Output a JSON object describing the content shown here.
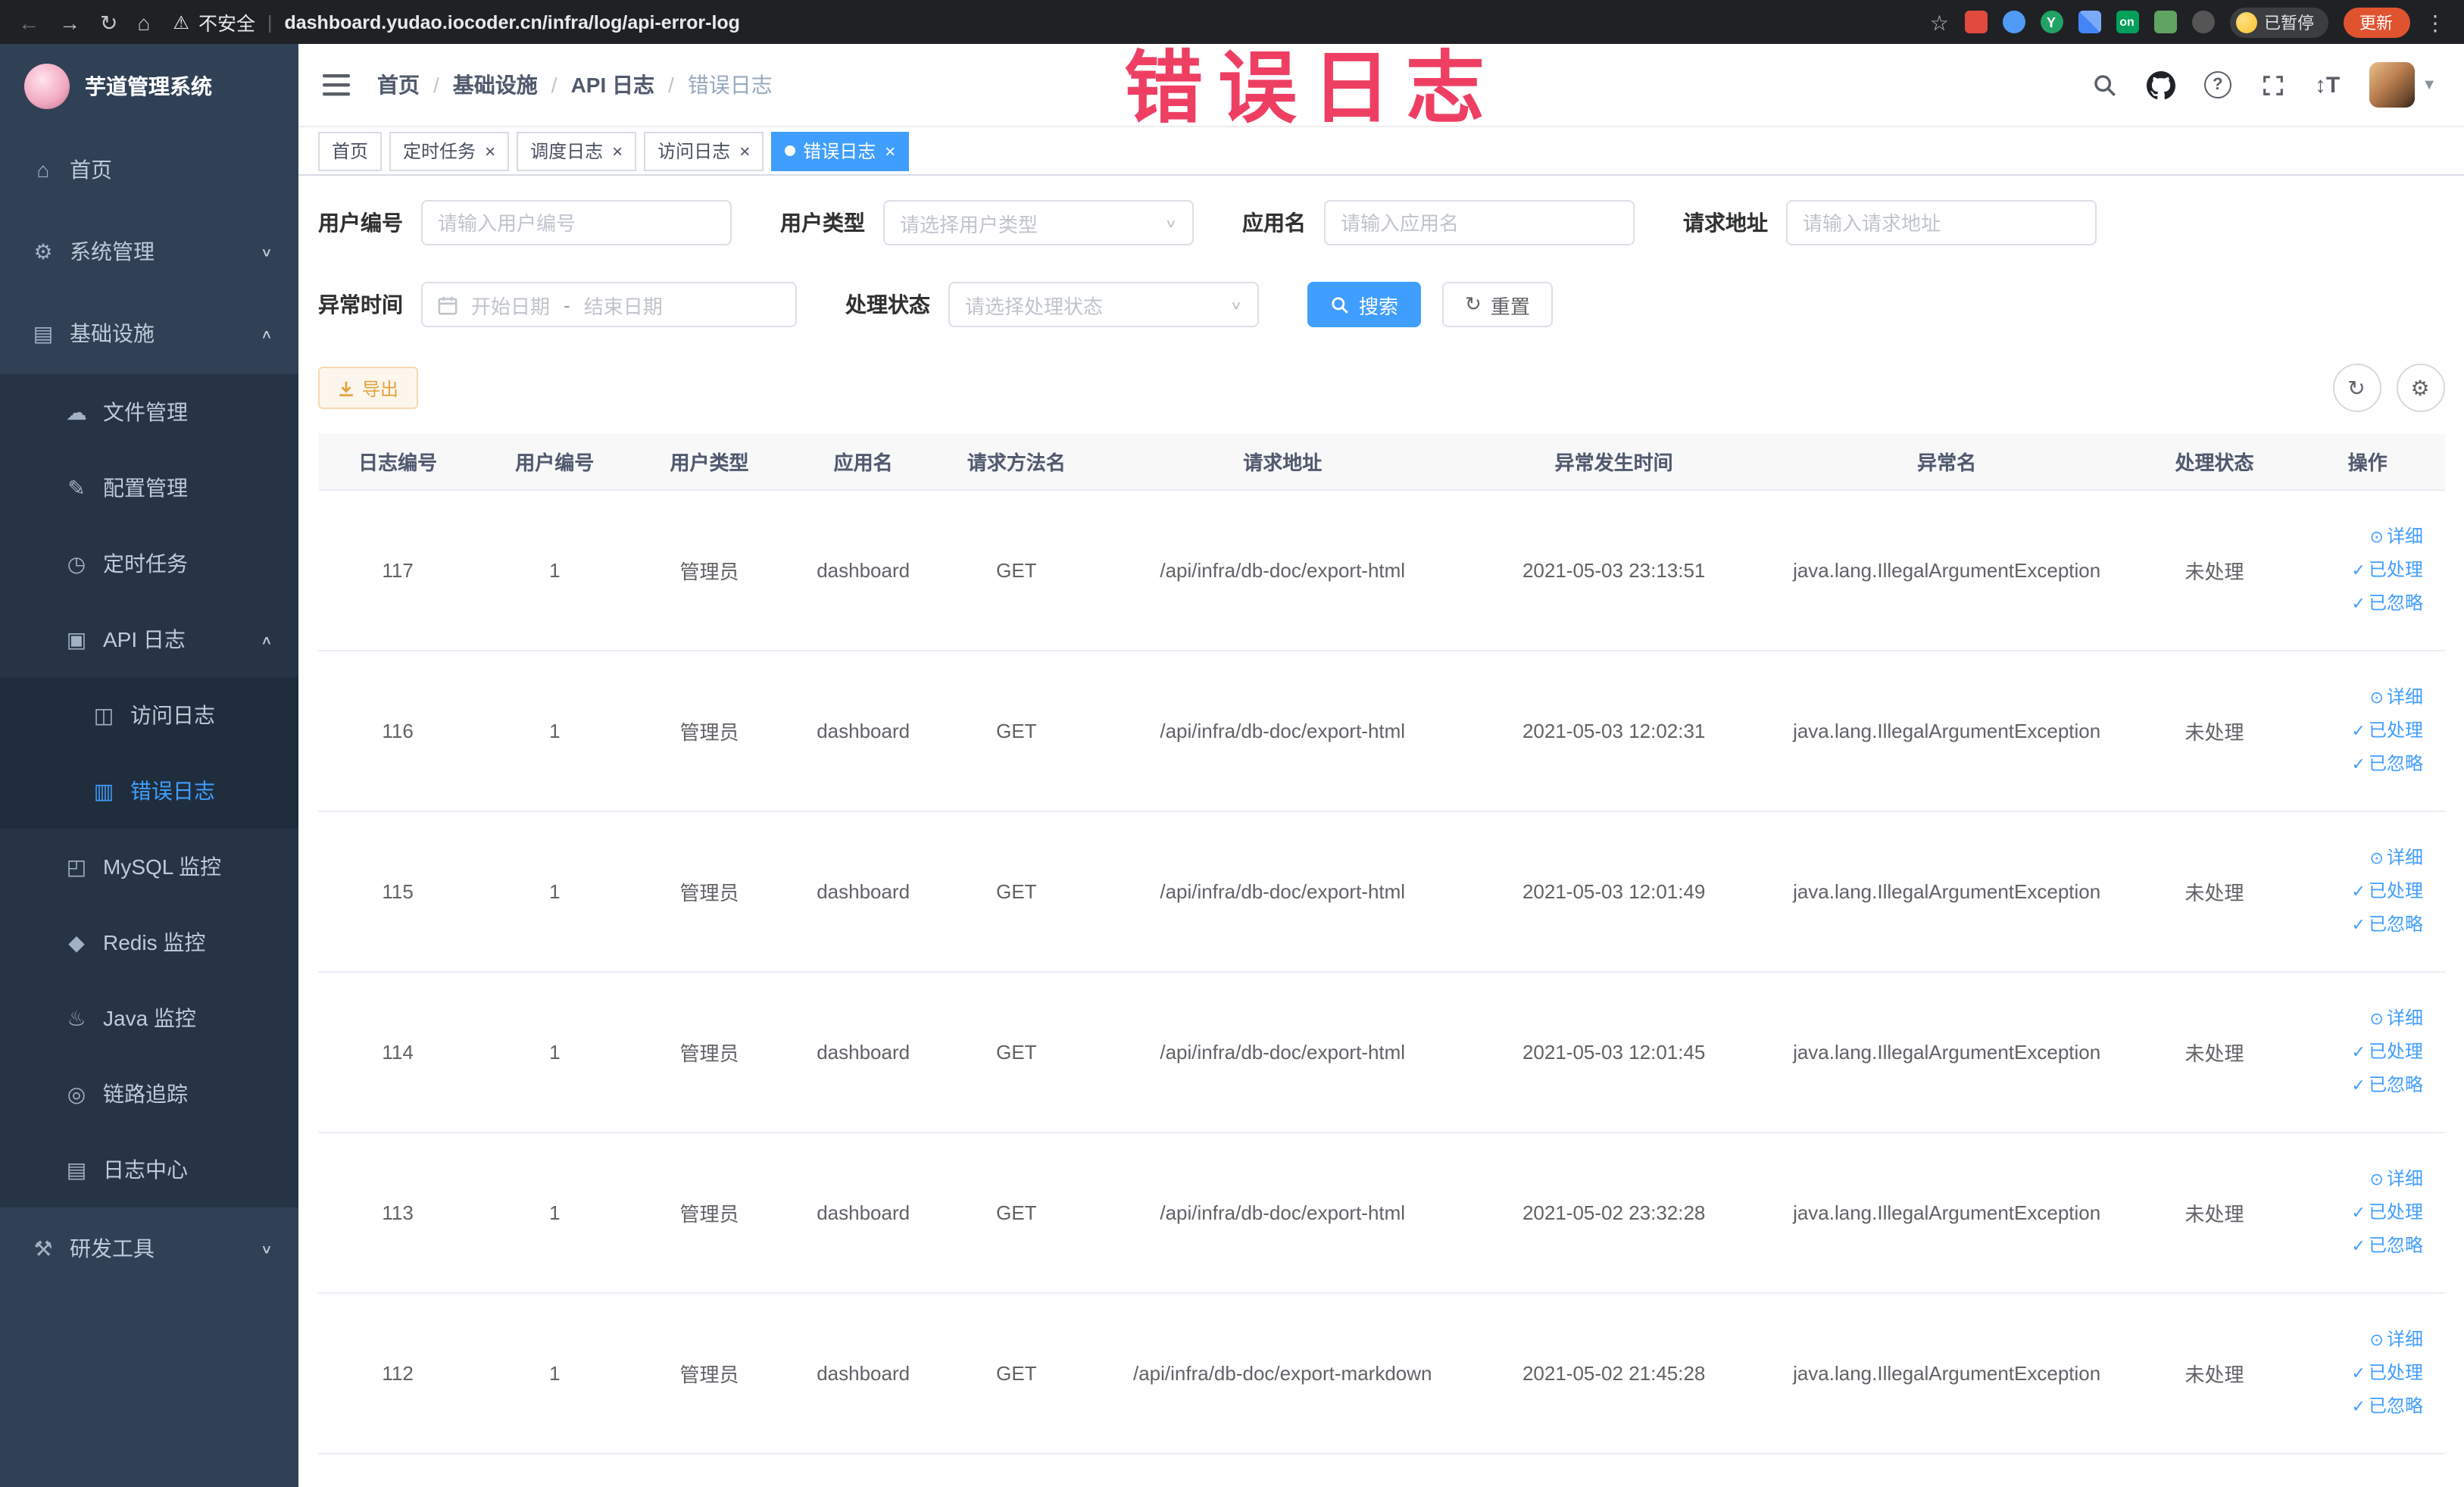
{
  "browser": {
    "security_text": "不安全",
    "url": "dashboard.yudao.iocoder.cn/infra/log/api-error-log",
    "paused_badge": "已暂停",
    "update_button": "更新"
  },
  "annotation": {
    "text": "错误日志",
    "color": "#ee3f63"
  },
  "sidebar": {
    "logo_title": "芋道管理系统",
    "items": [
      {
        "key": "home",
        "label": "首页",
        "icon": "home-icon",
        "glyph": "⌂",
        "level": 1
      },
      {
        "key": "system-mgmt",
        "label": "系统管理",
        "icon": "gear-icon",
        "glyph": "⚙",
        "level": 1,
        "chevron": "down"
      },
      {
        "key": "infrastructure",
        "label": "基础设施",
        "icon": "infra-icon",
        "glyph": "▤",
        "level": 1,
        "chevron": "up"
      },
      {
        "key": "file-mgmt",
        "label": "文件管理",
        "icon": "file-icon",
        "glyph": "☁",
        "level": 2
      },
      {
        "key": "config-mgmt",
        "label": "配置管理",
        "icon": "edit-icon",
        "glyph": "✎",
        "level": 2
      },
      {
        "key": "job",
        "label": "定时任务",
        "icon": "clock-icon",
        "glyph": "◷",
        "level": 2
      },
      {
        "key": "api-log",
        "label": "API 日志",
        "icon": "api-log-icon",
        "glyph": "▣",
        "level": 2,
        "chevron": "up"
      },
      {
        "key": "access-log",
        "label": "访问日志",
        "icon": "access-log-icon",
        "glyph": "◫",
        "level": 3
      },
      {
        "key": "error-log",
        "label": "错误日志",
        "icon": "error-log-icon",
        "glyph": "▥",
        "level": 3,
        "active": true
      },
      {
        "key": "mysql-monitor",
        "label": "MySQL 监控",
        "icon": "database-icon",
        "glyph": "◰",
        "level": 2
      },
      {
        "key": "redis-monitor",
        "label": "Redis 监控",
        "icon": "redis-icon",
        "glyph": "◆",
        "level": 2
      },
      {
        "key": "java-monitor",
        "label": "Java 监控",
        "icon": "java-icon",
        "glyph": "♨",
        "level": 2
      },
      {
        "key": "trace",
        "label": "链路追踪",
        "icon": "trace-icon",
        "glyph": "◎",
        "level": 2
      },
      {
        "key": "log-center",
        "label": "日志中心",
        "icon": "log-center-icon",
        "glyph": "▤",
        "level": 2
      },
      {
        "key": "dev-tools",
        "label": "研发工具",
        "icon": "tools-icon",
        "glyph": "⚒",
        "level": 1,
        "chevron": "down"
      }
    ]
  },
  "header": {
    "breadcrumbs": [
      "首页",
      "基础设施",
      "API 日志",
      "错误日志"
    ]
  },
  "tabs": [
    {
      "key": "home",
      "label": "首页",
      "closable": false,
      "active": false
    },
    {
      "key": "job",
      "label": "定时任务",
      "closable": true,
      "active": false
    },
    {
      "key": "job-log",
      "label": "调度日志",
      "closable": true,
      "active": false
    },
    {
      "key": "access-log",
      "label": "访问日志",
      "closable": true,
      "active": false
    },
    {
      "key": "error-log",
      "label": "错误日志",
      "closable": true,
      "active": true
    }
  ],
  "filters": {
    "user_id": {
      "label": "用户编号",
      "placeholder": "请输入用户编号"
    },
    "user_type": {
      "label": "用户类型",
      "placeholder": "请选择用户类型"
    },
    "app_name": {
      "label": "应用名",
      "placeholder": "请输入应用名"
    },
    "request_url": {
      "label": "请求地址",
      "placeholder": "请输入请求地址"
    },
    "exception_time": {
      "label": "异常时间",
      "start_placeholder": "开始日期",
      "separator": "-",
      "end_placeholder": "结束日期"
    },
    "process_status": {
      "label": "处理状态",
      "placeholder": "请选择处理状态"
    },
    "search_button": "搜索",
    "reset_button": "重置"
  },
  "toolbar": {
    "export_button": "导出"
  },
  "table": {
    "columns": [
      "日志编号",
      "用户编号",
      "用户类型",
      "应用名",
      "请求方法名",
      "请求地址",
      "异常发生时间",
      "异常名",
      "处理状态",
      "操作"
    ],
    "actions": {
      "detail": "详细",
      "processed": "已处理",
      "ignored": "已忽略"
    },
    "rows": [
      {
        "id": "117",
        "user_id": "1",
        "user_type": "管理员",
        "app": "dashboard",
        "method": "GET",
        "url": "/api/infra/db-doc/export-html",
        "time": "2021-05-03 23:13:51",
        "exception": "java.lang.IllegalArgumentException",
        "status": "未处理"
      },
      {
        "id": "116",
        "user_id": "1",
        "user_type": "管理员",
        "app": "dashboard",
        "method": "GET",
        "url": "/api/infra/db-doc/export-html",
        "time": "2021-05-03 12:02:31",
        "exception": "java.lang.IllegalArgumentException",
        "status": "未处理"
      },
      {
        "id": "115",
        "user_id": "1",
        "user_type": "管理员",
        "app": "dashboard",
        "method": "GET",
        "url": "/api/infra/db-doc/export-html",
        "time": "2021-05-03 12:01:49",
        "exception": "java.lang.IllegalArgumentException",
        "status": "未处理"
      },
      {
        "id": "114",
        "user_id": "1",
        "user_type": "管理员",
        "app": "dashboard",
        "method": "GET",
        "url": "/api/infra/db-doc/export-html",
        "time": "2021-05-03 12:01:45",
        "exception": "java.lang.IllegalArgumentException",
        "status": "未处理"
      },
      {
        "id": "113",
        "user_id": "1",
        "user_type": "管理员",
        "app": "dashboard",
        "method": "GET",
        "url": "/api/infra/db-doc/export-html",
        "time": "2021-05-02 23:32:28",
        "exception": "java.lang.IllegalArgumentException",
        "status": "未处理"
      },
      {
        "id": "112",
        "user_id": "1",
        "user_type": "管理员",
        "app": "dashboard",
        "method": "GET",
        "url": "/api/infra/db-doc/export-markdown",
        "time": "2021-05-02 21:45:28",
        "exception": "java.lang.IllegalArgumentException",
        "status": "未处理"
      }
    ]
  }
}
